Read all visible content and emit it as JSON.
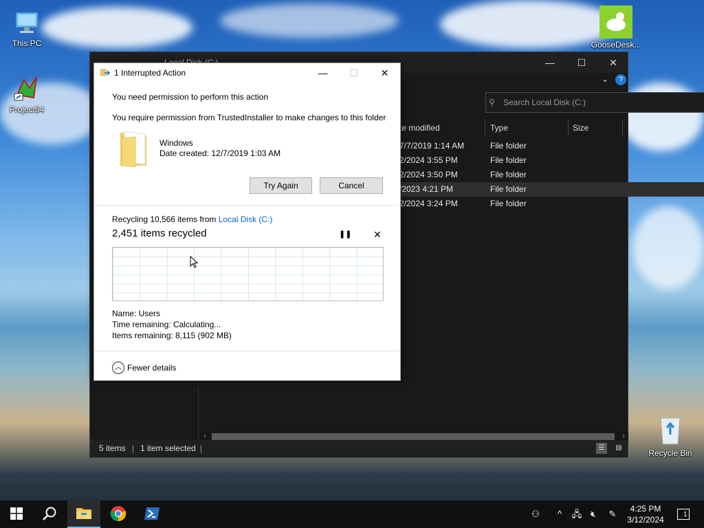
{
  "desktop": {
    "icons": [
      {
        "label": "This PC",
        "icon": "this-pc-icon"
      },
      {
        "label": "Project64",
        "icon": "project64-icon"
      },
      {
        "label": "GooseDesk...",
        "icon": "goose-icon"
      },
      {
        "label": "Recycle Bin",
        "icon": "recycle-bin-icon"
      }
    ]
  },
  "explorer": {
    "title": "Local Disk (C:)",
    "search_placeholder": "Search Local Disk (C:)",
    "columns": {
      "modified": "te modified",
      "type": "Type",
      "size": "Size"
    },
    "rows": [
      {
        "modified": "7/7/2019 1:14 AM",
        "type": "File folder",
        "selected": false
      },
      {
        "modified": "2/2024 3:55 PM",
        "type": "File folder",
        "selected": false
      },
      {
        "modified": "2/2024 3:50 PM",
        "type": "File folder",
        "selected": false
      },
      {
        "modified": "/2023 4:21 PM",
        "type": "File folder",
        "selected": true
      },
      {
        "modified": "2/2024 3:24 PM",
        "type": "File folder",
        "selected": false
      }
    ],
    "status": {
      "items": "5 items",
      "selected": "1 item selected"
    }
  },
  "dialog": {
    "title": "1 Interrupted Action",
    "heading": "You need permission to perform this action",
    "message": "You require permission from TrustedInstaller to make changes to this folder",
    "folder_name": "Windows",
    "date_created": "Date created: 12/7/2019 1:03 AM",
    "try_again_label": "Try Again",
    "cancel_label": "Cancel",
    "recycling_prefix": "Recycling 10,566 items from ",
    "recycling_location": "Local Disk (C:)",
    "recycled_count": "2,451 items recycled",
    "details": {
      "name_label": "Name:",
      "name_value": "Users",
      "time_label": "Time remaining:",
      "time_value": "Calculating...",
      "items_label": "Items remaining:",
      "items_value": "8,115 (902 MB)"
    },
    "fewer_details_label": "Fewer details"
  },
  "taskbar": {
    "apps": [
      {
        "name": "start",
        "icon": "windows-logo-icon"
      },
      {
        "name": "search",
        "icon": "search-icon"
      },
      {
        "name": "file-explorer",
        "icon": "folder-icon",
        "active": true
      },
      {
        "name": "chrome",
        "icon": "chrome-icon"
      },
      {
        "name": "powershell",
        "icon": "powershell-icon"
      }
    ],
    "time": "4:25 PM",
    "date": "3/12/2024",
    "notification_count": "1"
  },
  "colors": {
    "accent": "#0067c0",
    "link": "#0066cc",
    "explorer_bg": "#191919",
    "taskbar_bg": "#101010"
  }
}
